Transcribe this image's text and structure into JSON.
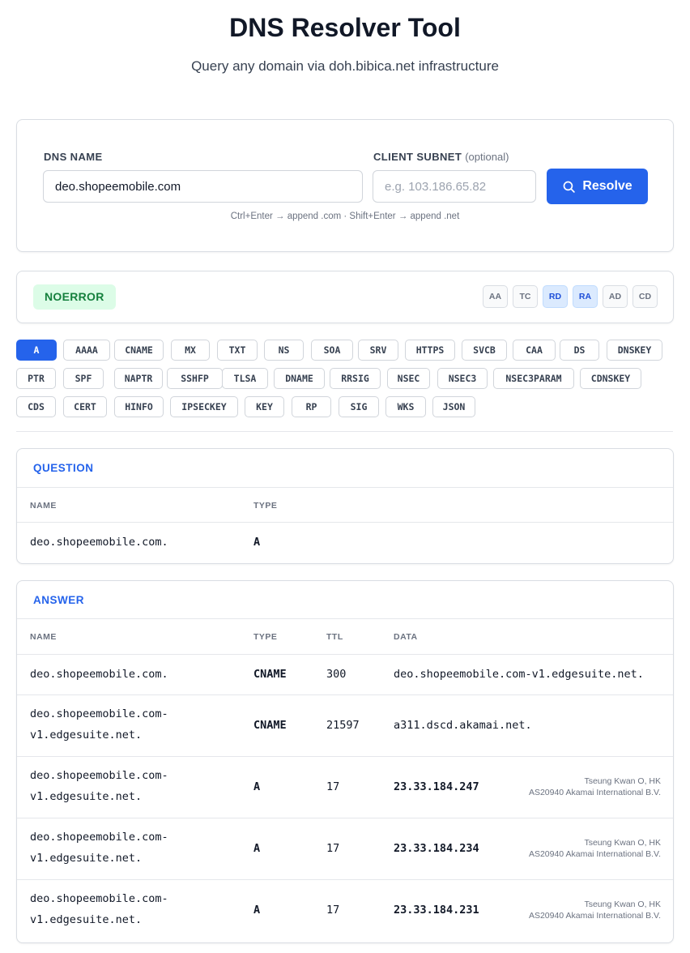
{
  "header": {
    "title": "DNS Resolver Tool",
    "subtitle": "Query any domain via doh.bibica.net infrastructure"
  },
  "form": {
    "dns_name_label": "DNS NAME",
    "dns_name_value": "deo.shopeemobile.com",
    "client_subnet_label": "CLIENT SUBNET",
    "client_subnet_optional": "(optional)",
    "client_subnet_placeholder": "e.g. 103.186.65.82",
    "resolve_label": "Resolve",
    "hint": "Ctrl+Enter → append .com  ·  Shift+Enter → append .net"
  },
  "status": {
    "rcode": "NOERROR",
    "flags": [
      {
        "label": "AA",
        "active": false
      },
      {
        "label": "TC",
        "active": false
      },
      {
        "label": "RD",
        "active": true
      },
      {
        "label": "RA",
        "active": true
      },
      {
        "label": "AD",
        "active": false
      },
      {
        "label": "CD",
        "active": false
      }
    ]
  },
  "record_types": {
    "active": "A",
    "rows": [
      [
        "A",
        "AAAA",
        "CNAME",
        "MX",
        "TXT",
        "NS",
        "SOA",
        "SRV",
        "HTTPS",
        "SVCB",
        "CAA",
        "DS",
        "DNSKEY"
      ],
      [
        "PTR",
        "SPF",
        "NAPTR",
        "SSHFP",
        "TLSA",
        "DNAME",
        "RRSIG",
        "NSEC",
        "NSEC3",
        "NSEC3PARAM",
        "CDNSKEY"
      ],
      [
        "CDS",
        "CERT",
        "HINFO",
        "IPSECKEY",
        "KEY",
        "RP",
        "SIG",
        "WKS",
        "JSON"
      ]
    ]
  },
  "question": {
    "title": "QUESTION",
    "columns": [
      "NAME",
      "TYPE"
    ],
    "rows": [
      {
        "name": "deo.shopeemobile.com.",
        "type": "A"
      }
    ]
  },
  "answer": {
    "title": "ANSWER",
    "columns": [
      "NAME",
      "TYPE",
      "TTL",
      "DATA"
    ],
    "rows": [
      {
        "name": "deo.shopeemobile.com.",
        "type": "CNAME",
        "ttl": "300",
        "data": "deo.shopeemobile.com-v1.edgesuite.net.",
        "location": "",
        "asn": ""
      },
      {
        "name": "deo.shopeemobile.com-v1.edgesuite.net.",
        "type": "CNAME",
        "ttl": "21597",
        "data": "a311.dscd.akamai.net.",
        "location": "",
        "asn": ""
      },
      {
        "name": "deo.shopeemobile.com-v1.edgesuite.net.",
        "type": "A",
        "ttl": "17",
        "data": "23.33.184.247",
        "location": "Tseung Kwan O, HK",
        "asn": "AS20940 Akamai International B.V."
      },
      {
        "name": "deo.shopeemobile.com-v1.edgesuite.net.",
        "type": "A",
        "ttl": "17",
        "data": "23.33.184.234",
        "location": "Tseung Kwan O, HK",
        "asn": "AS20940 Akamai International B.V."
      },
      {
        "name": "deo.shopeemobile.com-v1.edgesuite.net.",
        "type": "A",
        "ttl": "17",
        "data": "23.33.184.231",
        "location": "Tseung Kwan O, HK",
        "asn": "AS20940 Akamai International B.V."
      }
    ]
  }
}
